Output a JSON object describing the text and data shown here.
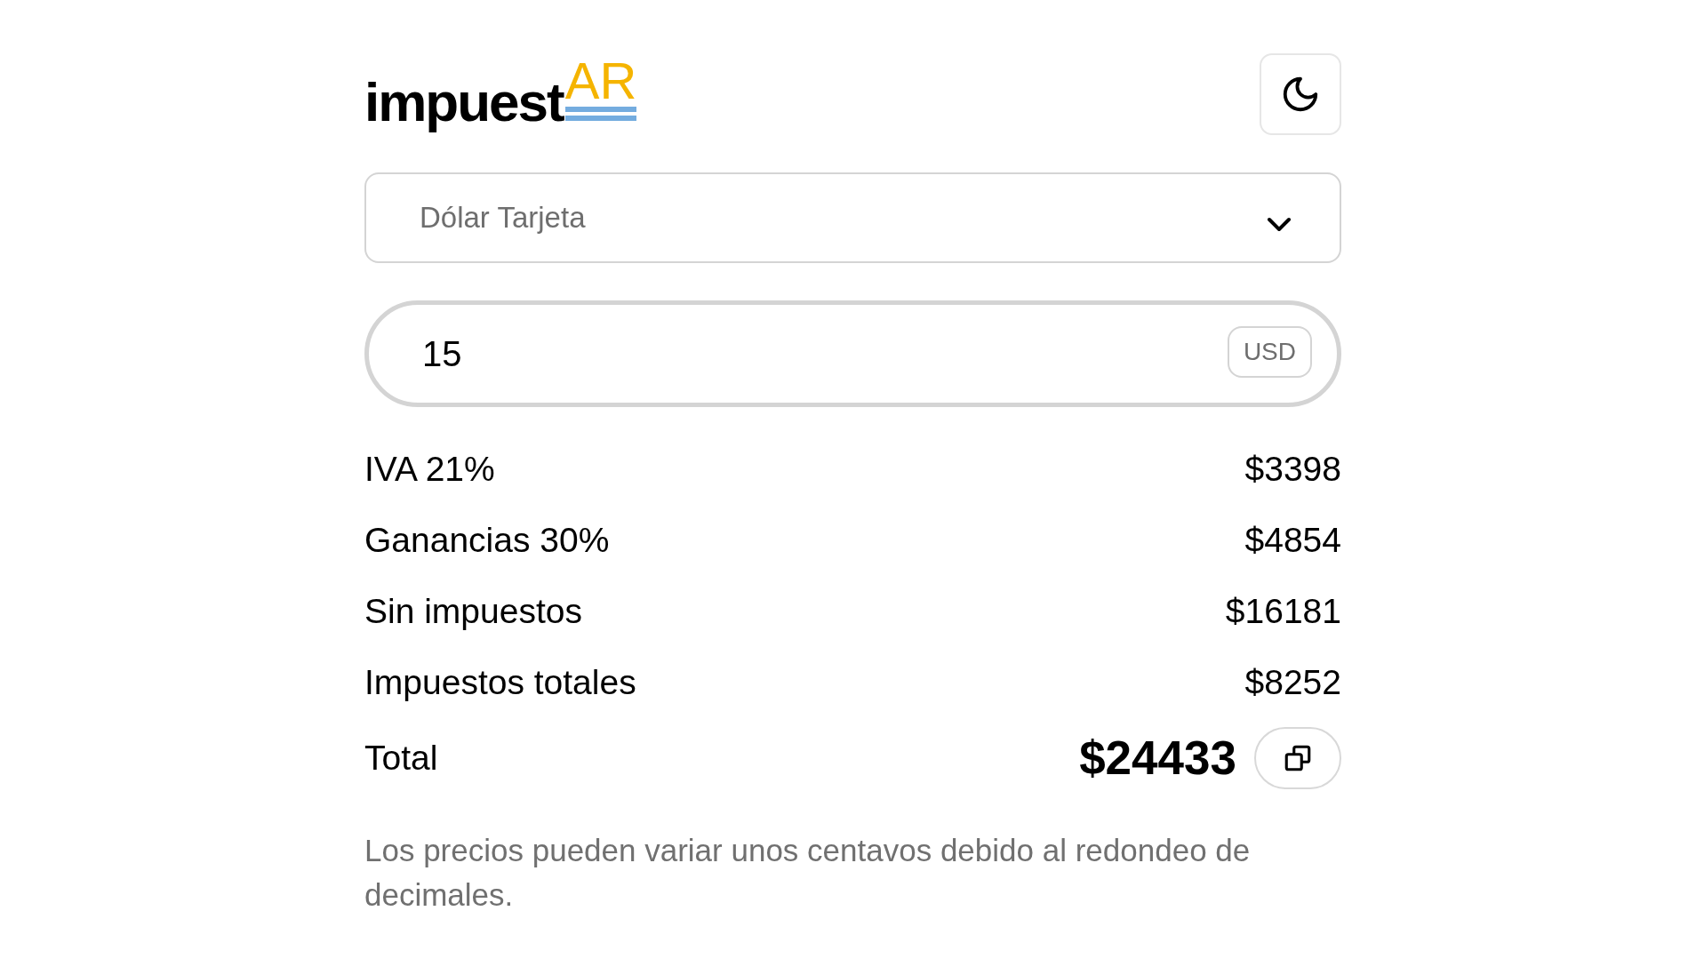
{
  "logo": {
    "text": "impuest",
    "accent": "AR"
  },
  "theme_toggle": {
    "dark": false
  },
  "currency_type": {
    "value": "Dólar Tarjeta"
  },
  "amount": {
    "value": "15",
    "unit": "USD"
  },
  "breakdown": [
    {
      "label": "IVA 21%",
      "amount": "$3398"
    },
    {
      "label": "Ganancias 30%",
      "amount": "$4854"
    },
    {
      "label": "Sin impuestos",
      "amount": "$16181"
    },
    {
      "label": "Impuestos totales",
      "amount": "$8252"
    }
  ],
  "total": {
    "label": "Total",
    "amount": "$24433"
  },
  "note": "Los precios pueden variar unos centavos debido al redondeo de decimales."
}
